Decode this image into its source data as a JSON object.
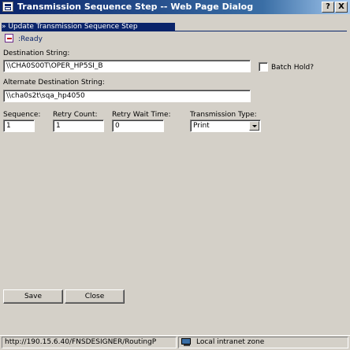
{
  "window": {
    "title": "Transmission Sequence Step -- Web Page Dialog",
    "help_button": "?",
    "close_button": "X"
  },
  "section": {
    "title": "» Update Transmission Sequence Step"
  },
  "status": {
    "text": ":Ready"
  },
  "fields": {
    "destination": {
      "label": "Destination String:",
      "value": "\\\\CHA0S00T\\OPER_HP5SI_B"
    },
    "batch_hold": {
      "label": "Batch Hold?",
      "checked": false
    },
    "alternate": {
      "label": "Alternate Destination String:",
      "value": "\\\\cha0s2t\\sqa_hp4050"
    },
    "sequence": {
      "label": "Sequence:",
      "value": "1"
    },
    "retry_count": {
      "label": "Retry Count:",
      "value": "1"
    },
    "retry_wait": {
      "label": "Retry Wait Time:",
      "value": "0"
    },
    "transmission_type": {
      "label": "Transmission Type:",
      "value": "Print"
    }
  },
  "buttons": {
    "save": "Save",
    "close": "Close"
  },
  "statusbar": {
    "url": "http://190.15.6.40/FNSDESIGNER/RoutingP",
    "zone": "Local intranet zone"
  }
}
